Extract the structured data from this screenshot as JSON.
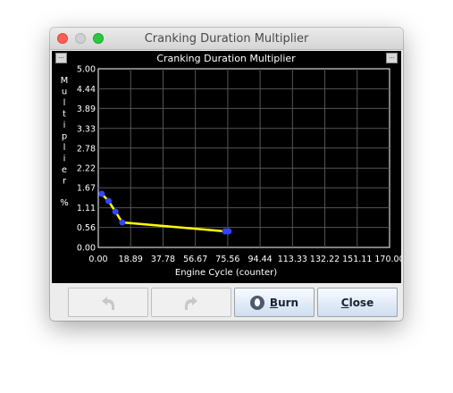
{
  "window": {
    "title": "Cranking Duration Multiplier"
  },
  "colors": {
    "line": "#ffff00",
    "point": "#3344ff",
    "grid": "#555555",
    "axis": "#ffffff",
    "background": "#000000"
  },
  "toolbar": {
    "undo_icon": "undo-icon",
    "redo_icon": "redo-icon",
    "burn_label": "Burn",
    "burn_icon": "flame-icon",
    "close_label": "Close"
  },
  "chart_data": {
    "type": "line",
    "title": "Cranking Duration Multiplier",
    "xlabel": "Engine Cycle (counter)",
    "ylabel": "Multiplier %",
    "xlim": [
      0,
      170
    ],
    "ylim": [
      0,
      5
    ],
    "grid": true,
    "xticks": [
      "0.00",
      "18.89",
      "37.78",
      "56.67",
      "75.56",
      "94.44",
      "113.33",
      "132.22",
      "151.11",
      "170.00"
    ],
    "yticks": [
      "0.00",
      "0.56",
      "1.11",
      "1.67",
      "2.22",
      "2.78",
      "3.33",
      "3.89",
      "4.44",
      "5.00"
    ],
    "series": [
      {
        "x": [
          2,
          6,
          10,
          14,
          74,
          76
        ],
        "y": [
          1.5,
          1.3,
          1.0,
          0.7,
          0.45,
          0.45
        ]
      }
    ]
  }
}
